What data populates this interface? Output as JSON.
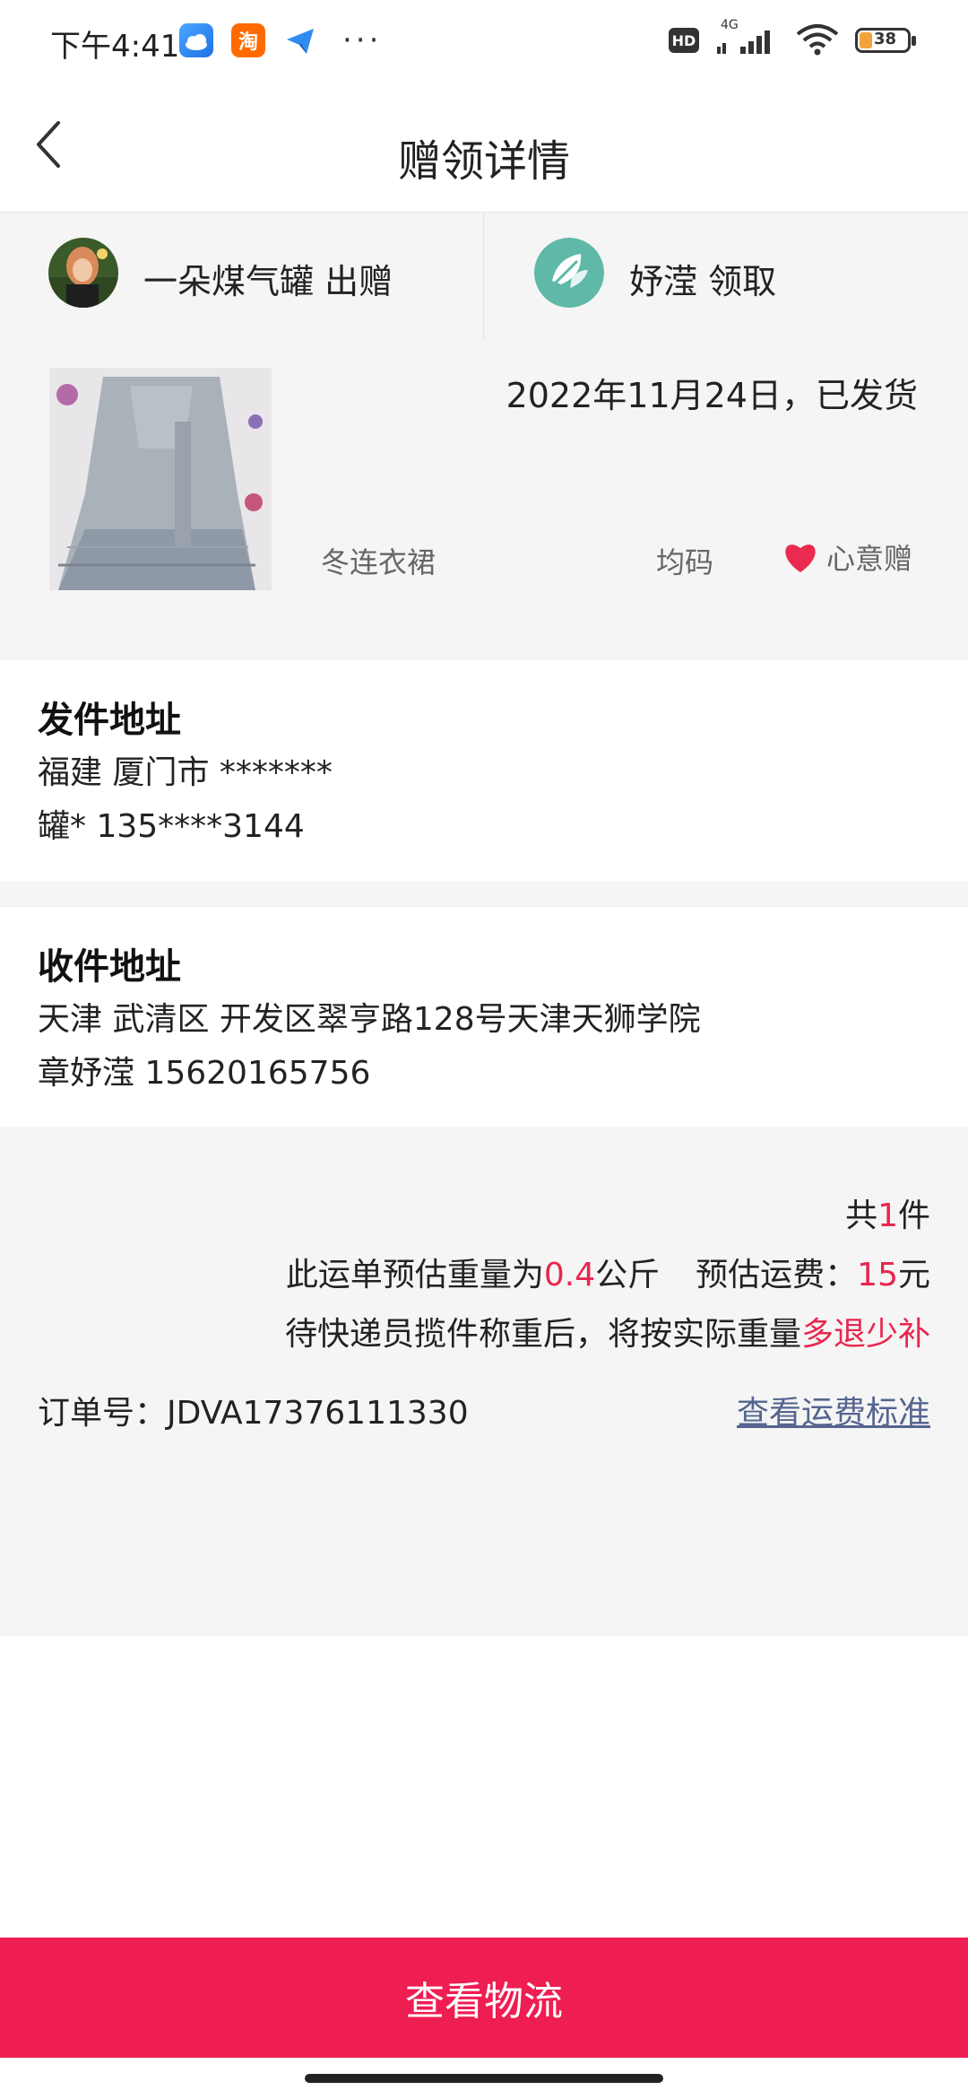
{
  "status_bar": {
    "time": "下午4:41",
    "hd": "HD",
    "network": "4G",
    "battery": "38",
    "app_icon_label_taobao": "淘"
  },
  "header": {
    "title": "赠领详情"
  },
  "parties": {
    "giver": "一朵煤气罐 出赠",
    "receiver": "妤滢 领取"
  },
  "item": {
    "ship_status": "2022年11月24日，已发货",
    "name": "冬连衣裙",
    "size": "均码",
    "tag": "心意赠"
  },
  "send_address": {
    "title": "发件地址",
    "line1": "福建 厦门市 *******",
    "line2": "罐* 135****3144"
  },
  "receive_address": {
    "title": "收件地址",
    "line1": "天津 武清区 开发区翠亨路128号天津天狮学院",
    "line2": "章妤滢 15620165756"
  },
  "summary": {
    "count_prefix": "共",
    "count": "1",
    "count_suffix": "件",
    "weight_prefix": "此运单预估重量为",
    "weight": "0.4",
    "weight_suffix": "公斤",
    "fee_prefix": "预估运费：",
    "fee": "15",
    "fee_suffix": "元",
    "note_prefix": "待快递员揽件称重后，将按实际重量",
    "note_highlight": "多退少补",
    "order_label": "订单号：JDVA17376111330",
    "fee_link": "查看运费标准"
  },
  "bottom_button": {
    "label": "查看物流"
  },
  "colors": {
    "accent": "#ee1d52",
    "highlight": "#e8264f",
    "link": "#55658f",
    "panel_bg": "#f5f5f5"
  },
  "icons": [
    "back-chevron-icon",
    "heart-icon",
    "wifi-icon",
    "signal-icon",
    "battery-icon"
  ]
}
